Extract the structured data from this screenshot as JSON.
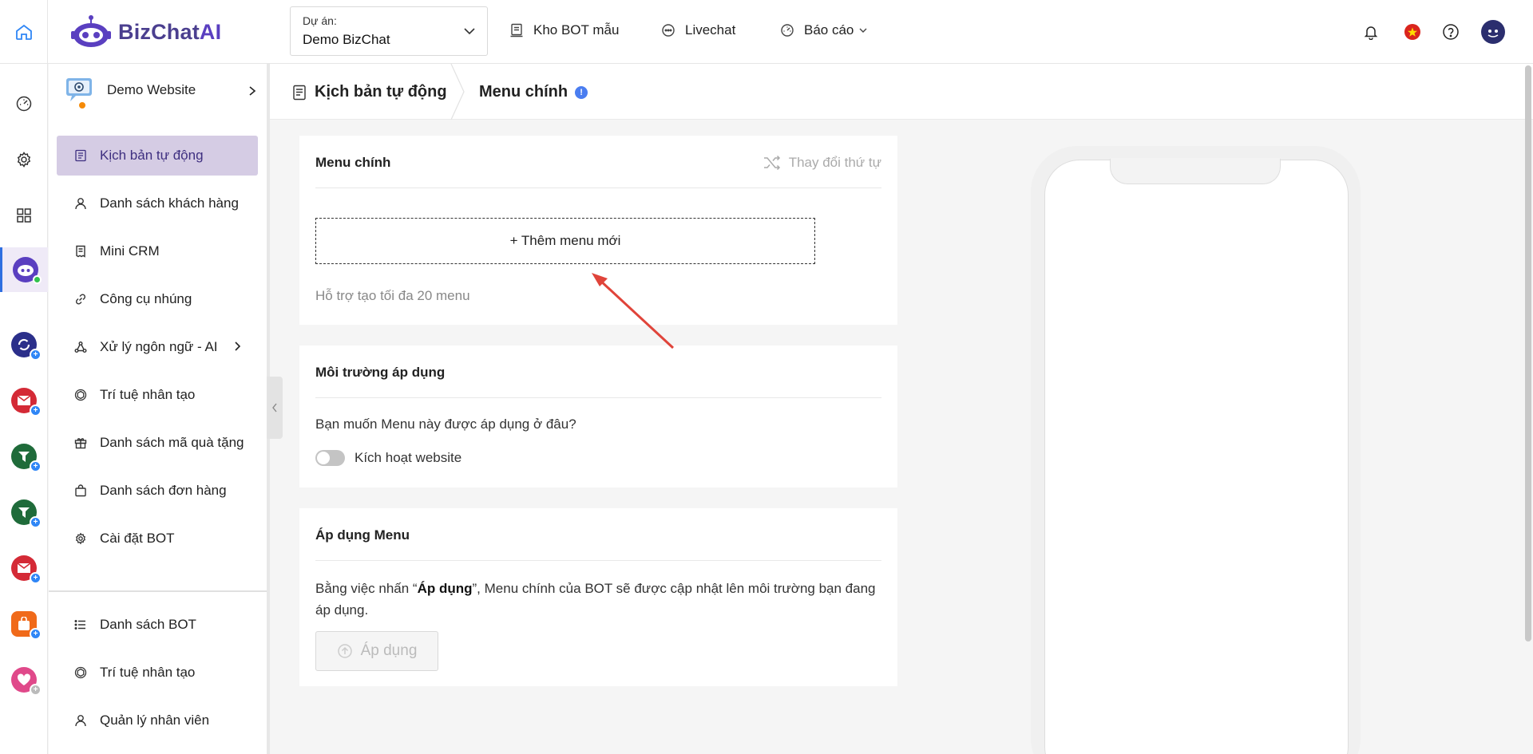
{
  "brand": {
    "name_part1": "BizChat",
    "name_part2": "AI"
  },
  "topbar": {
    "project_label": "Dự án:",
    "project_value": "Demo BizChat",
    "nav": [
      {
        "label": "Kho BOT mẫu",
        "icon": "bot-template-icon"
      },
      {
        "label": "Livechat",
        "icon": "chat-icon"
      },
      {
        "label": "Báo cáo",
        "icon": "dashboard-icon"
      }
    ]
  },
  "bot": {
    "name": "Demo Website"
  },
  "menu": {
    "items": [
      {
        "label": "Kịch bản tự động",
        "icon": "script-icon",
        "active": true
      },
      {
        "label": "Danh sách khách hàng",
        "icon": "user-icon"
      },
      {
        "label": "Mini CRM",
        "icon": "crm-icon"
      },
      {
        "label": "Công cụ nhúng",
        "icon": "link-icon"
      },
      {
        "label": "Xử lý ngôn ngữ - AI",
        "icon": "nlp-icon",
        "has_submenu": true
      },
      {
        "label": "Trí tuệ nhân tạo",
        "icon": "ai-icon"
      },
      {
        "label": "Danh sách mã quà tặng",
        "icon": "gift-icon"
      },
      {
        "label": "Danh sách đơn hàng",
        "icon": "bag-icon"
      },
      {
        "label": "Cài đặt BOT",
        "icon": "gear-icon"
      }
    ],
    "bottom_items": [
      {
        "label": "Danh sách BOT",
        "icon": "list-icon"
      },
      {
        "label": "Trí tuệ nhân tạo",
        "icon": "ai-icon"
      },
      {
        "label": "Quản lý nhân viên",
        "icon": "user-icon"
      }
    ]
  },
  "breadcrumb": {
    "section": "Kịch bản tự động",
    "page": "Menu chính",
    "info_glyph": "!"
  },
  "main_menu_card": {
    "title": "Menu chính",
    "reorder_label": "Thay đổi thứ tự",
    "add_button": "+ Thêm menu mới",
    "hint": "Hỗ trợ tạo tối đa 20 menu"
  },
  "environment_card": {
    "title": "Môi trường áp dụng",
    "question": "Bạn muốn Menu này được áp dụng ở đâu?",
    "toggle_label": "Kích hoạt website",
    "toggle_on": false
  },
  "apply_card": {
    "title": "Áp dụng Menu",
    "text_before": "Bằng việc nhấn “",
    "text_bold": "Áp dụng",
    "text_after": "”, Menu chính của BOT sẽ được cập nhật lên môi trường bạn đang áp dụng.",
    "button": "Áp dụng"
  },
  "colors": {
    "brand": "#4b3f8f",
    "active_menu_bg": "#d5cce4",
    "info_blue": "#4a7df0",
    "annotation_arrow": "#e0443a"
  }
}
